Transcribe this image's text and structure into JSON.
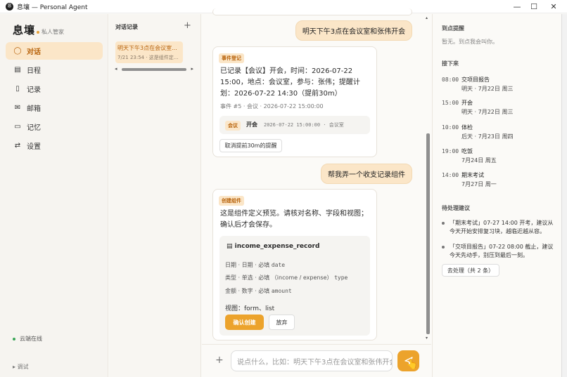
{
  "window": {
    "title": "息壤 — Personal Agent",
    "app_icon": "息"
  },
  "brand": {
    "name": "息壤",
    "subtitle": "私人管家"
  },
  "nav": [
    {
      "label": "对话",
      "icon": "chat-icon"
    },
    {
      "label": "日程",
      "icon": "calendar-icon"
    },
    {
      "label": "记录",
      "icon": "record-icon"
    },
    {
      "label": "邮箱",
      "icon": "mail-icon"
    },
    {
      "label": "记忆",
      "icon": "memory-icon"
    },
    {
      "label": "设置",
      "icon": "settings-icon"
    }
  ],
  "status": {
    "cloud": "云端在线",
    "debug": "▸ 调试"
  },
  "history": {
    "header": "对话记录",
    "items": [
      {
        "title": "明天下午3点在会议室...",
        "meta": "7/21 23:54 · 这是组件定..."
      }
    ]
  },
  "chat": {
    "msg1": "明天下午3点在会议室和张伟开会",
    "card1": {
      "tag": "事件登记",
      "line1": "已记录【会议】开会，时间：2026-07-22",
      "line2": "15:00，地点：会议室，参与：张伟；提醒计",
      "line3": "划：2026-07-22 14:30（提前30m）",
      "meta": "事件 #5 · 会议 · 2026-07-22 15:00:00",
      "event": {
        "type": "会议",
        "name": "开会",
        "detail": "2026-07-22 15:00:00 · 会议室"
      },
      "cancel_btn": "取消提前30m的提醒"
    },
    "msg2": "帮我弄一个收支记录组件",
    "card2": {
      "tag": "创建组件",
      "line1": "这是组件定义预览。请核对名称、字段和视图；",
      "line2": "确认后才会保存。",
      "component_name": "income_expense_record",
      "fields": [
        {
          "label": "日期 · 日期 · 必填",
          "key": "date"
        },
        {
          "label": "类型 · 单选 · 必填 （income / expense）",
          "key": "type"
        },
        {
          "label": "金额 · 数字 · 必填",
          "key": "amount"
        }
      ],
      "views": "视图：form、list",
      "confirm_btn": "确认创建",
      "discard_btn": "放弃"
    },
    "input_placeholder": "说点什么，比如：明天下午3点在会议室和张伟开会"
  },
  "right": {
    "reminders_title": "到点提醒",
    "reminders_empty": "暂无。到点我会叫你。",
    "upcoming_title": "接下来",
    "upcoming": [
      {
        "time": "08:00",
        "title": "交项目报告",
        "date": "明天 · 7月22日 周三"
      },
      {
        "time": "15:00",
        "title": "开会",
        "date": "明天 · 7月22日 周三"
      },
      {
        "time": "10:00",
        "title": "体检",
        "date": "后天 · 7月23日 周四"
      },
      {
        "time": "19:00",
        "title": "吃饭",
        "date": "7月24日 周五"
      },
      {
        "time": "14:00",
        "title": "期末考试",
        "date": "7月27日 周一"
      }
    ],
    "suggestions_title": "待处理建议",
    "suggestions": [
      {
        "a": "「期末考试」07-27 14:00 开考，建议从",
        "b": "今天开始安排复习块，越临近越从容。"
      },
      {
        "a": "「交项目报告」07-22 08:00 截止，建议",
        "b": "今天先动手，别压到最后一刻。"
      }
    ],
    "process_btn": "去处理（共 2 条）"
  },
  "colors": {
    "accent": "#eca32c",
    "accent_bg": "#fbe6c8",
    "accent_text": "#b8630b"
  }
}
